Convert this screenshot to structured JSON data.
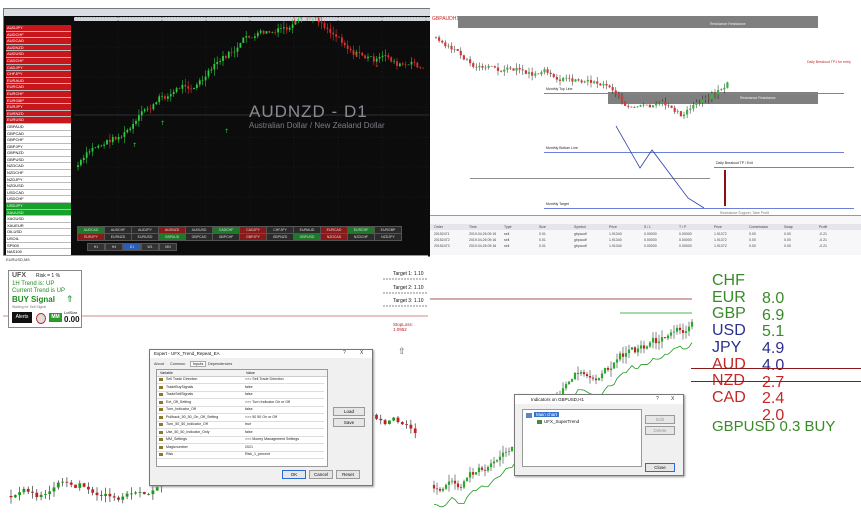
{
  "mt4": {
    "market_watch": [
      {
        "symbol": "AUDJPY",
        "style": "red"
      },
      {
        "symbol": "AUDCHF",
        "style": "red"
      },
      {
        "symbol": "AUDCAD",
        "style": "red"
      },
      {
        "symbol": "AUDNZD",
        "style": "red"
      },
      {
        "symbol": "AUDUSD",
        "style": "red"
      },
      {
        "symbol": "CADCHF",
        "style": "red"
      },
      {
        "symbol": "CADJPY",
        "style": "red"
      },
      {
        "symbol": "CHFJPY",
        "style": "red"
      },
      {
        "symbol": "EURAUD",
        "style": "red"
      },
      {
        "symbol": "EURCAD",
        "style": "red"
      },
      {
        "symbol": "EURCHF",
        "style": "red"
      },
      {
        "symbol": "EURGBP",
        "style": "red"
      },
      {
        "symbol": "EURJPY",
        "style": "red"
      },
      {
        "symbol": "EURNZD",
        "style": "red"
      },
      {
        "symbol": "EURUSD",
        "style": "red"
      },
      {
        "symbol": "GBPAUD",
        "style": "white"
      },
      {
        "symbol": "GBPCAD",
        "style": "white"
      },
      {
        "symbol": "GBPCHF",
        "style": "white"
      },
      {
        "symbol": "GBPJPY",
        "style": "white"
      },
      {
        "symbol": "GBPNZD",
        "style": "white"
      },
      {
        "symbol": "GBPUSD",
        "style": "white"
      },
      {
        "symbol": "NZDCAD",
        "style": "white"
      },
      {
        "symbol": "NZDCHF",
        "style": "white"
      },
      {
        "symbol": "NZDJPY",
        "style": "white"
      },
      {
        "symbol": "NZDUSD",
        "style": "white"
      },
      {
        "symbol": "USDCAD",
        "style": "white"
      },
      {
        "symbol": "USDCHF",
        "style": "white"
      },
      {
        "symbol": "USDJPY",
        "style": "green"
      },
      {
        "symbol": "XAUUSD",
        "style": "green"
      },
      {
        "symbol": "XAGUSD",
        "style": "white"
      },
      {
        "symbol": "XAUEUR",
        "style": "white"
      },
      {
        "symbol": "OILUSD",
        "style": "white"
      },
      {
        "symbol": "USOIL",
        "style": "white"
      },
      {
        "symbol": "SP500",
        "style": "white"
      },
      {
        "symbol": "NAS100",
        "style": "white"
      }
    ],
    "watermark": "AUDNZD - D1",
    "watermark_sub": "Australian Dollar / New Zealand Dollar",
    "dashboard_pairs": [
      "AUDCAD",
      "AUDCHF",
      "AUDJPY",
      "AUDNZD",
      "AUDUSD",
      "CADCHF",
      "CADJPY",
      "CHFJPY",
      "EURAUD",
      "EURCAD",
      "EURCHF",
      "EURGBP",
      "EURJPY",
      "EURNZD",
      "EURUSD",
      "GBPAUD",
      "GBPCAD",
      "GBPCHF",
      "GBPJPY",
      "GBPNZD",
      "GBPUSD",
      "NZDCAD",
      "NZDCHF",
      "NZDJPY"
    ],
    "timeframes": [
      "H1",
      "H4",
      "D1",
      "W1",
      "MN"
    ]
  },
  "q2": {
    "title": "GBPAUDH1 1.0",
    "labels": {
      "z1": "Resistance Resistance",
      "z2": "Resistance Resistance",
      "l1": "Monthly Top Line",
      "l2": "Monthly Bottom Line",
      "l3": "Daily Breakout TP / Exit",
      "l4": "Monthly Target",
      "r1": "Daily Breakout TP1 for entry",
      "r2": "Resistance Support, Take Profit"
    },
    "table_headers": [
      "Order",
      "Time",
      "Type",
      "Size",
      "Symbol",
      "Price",
      "S / L",
      "T / P",
      "Price",
      "Commission",
      "Swap",
      "Profit"
    ],
    "rows": [
      [
        "20152471",
        "2019.04.26 09:15",
        "sell",
        "0.01",
        "gbpaudf",
        "1.91340",
        "0.00000",
        "0.00000",
        "1.91372",
        "0.00",
        "0.00",
        "-0.21"
      ],
      [
        "20152472",
        "2019.04.26 09:16",
        "sell",
        "0.01",
        "gbpaudf",
        "1.91340",
        "0.00000",
        "0.00000",
        "1.91372",
        "0.00",
        "0.00",
        "-0.21"
      ],
      [
        "20152473",
        "2019.04.26 09:16",
        "sell",
        "0.01",
        "gbpaudf",
        "1.91340",
        "0.00000",
        "0.00000",
        "1.91372",
        "0.00",
        "0.00",
        "-0.21"
      ]
    ]
  },
  "q3": {
    "symbol_header": "EURUSD,M5",
    "indicator": {
      "title": "UFX",
      "risk": "Risk = 1 %",
      "h1_trend": "1H Trend is: UP",
      "current_trend": "Current Trend is UP",
      "signal": "BUY Signal",
      "waiting": "Waiting for Sell Signal",
      "alerts_btn": "Alerts",
      "mm_btn": "MM",
      "lotsize_label": "LotSize",
      "lotsize_value": "0.00"
    },
    "targets": {
      "t1": "Target 1: 1.10",
      "t2": "Target 2: 1.10",
      "t3": "Target 3: 1.10",
      "sl": "StopLoss: 1.0952"
    },
    "dialog": {
      "title": "Expert - UFX_Trend_Repeat_EA",
      "tabs": [
        "About",
        "Common",
        "Inputs",
        "Dependencies"
      ],
      "col_variable": "Variable",
      "col_value": "Value",
      "rows": [
        {
          "var": "Sell Trade Direction",
          "val": ">>> Sell Trade Direction"
        },
        {
          "var": "TradeBuySignals",
          "val": "false"
        },
        {
          "var": "TradeSellSignals",
          "val": "false"
        },
        {
          "var": "Ext_Off_Setting",
          "val": ">>> Turn Indicator On or Off"
        },
        {
          "var": "Turn_Indicator_Off",
          "val": "false"
        },
        {
          "var": "Pullback_50_50_On_Off_Setting",
          "val": ">>> 50 50 On or Off"
        },
        {
          "var": "Turn_50_50_Indicator_Off",
          "val": "true"
        },
        {
          "var": "Use_50_50_Indicator_Only",
          "val": "false"
        },
        {
          "var": "MM_Settings",
          "val": ">>> Money Management Settings"
        },
        {
          "var": "Magicnumber",
          "val": "2021"
        },
        {
          "var": "Risk",
          "val": "Risk_1_percent"
        }
      ],
      "load_btn": "Load",
      "save_btn": "Save",
      "ok_btn": "OK",
      "cancel_btn": "Cancel",
      "reset_btn": "Reset",
      "help_btn": "?",
      "close_btn": "X"
    }
  },
  "q4": {
    "strength": [
      {
        "ccy": "CHF",
        "val": "8.0",
        "color": "#3a8a2a"
      },
      {
        "ccy": "EUR",
        "val": "6.9",
        "color": "#3a8a2a"
      },
      {
        "ccy": "GBP",
        "val": "5.1",
        "color": "#3a8a2a"
      },
      {
        "ccy": "USD",
        "val": "4.9",
        "color": "#2b2f8f"
      },
      {
        "ccy": "JPY",
        "val": "4.0",
        "color": "#2b2f8f"
      },
      {
        "ccy": "AUD",
        "val": "2.7",
        "color": "#c42727"
      },
      {
        "ccy": "NZD",
        "val": "2.4",
        "color": "#c42727"
      },
      {
        "ccy": "CAD",
        "val": "2.0",
        "color": "#c42727"
      }
    ],
    "summary": "GBPUSD 0.3 BUY",
    "summary_color": "#3a8a2a",
    "dialog": {
      "title": "Indicators on GBPUSD,H1",
      "tree_root": "Main chart",
      "tree_child": "UFX_SuperTrend",
      "edit_btn": "Edit",
      "delete_btn": "Delete",
      "close_btn": "Close",
      "help_btn": "?",
      "x_btn": "X"
    }
  }
}
